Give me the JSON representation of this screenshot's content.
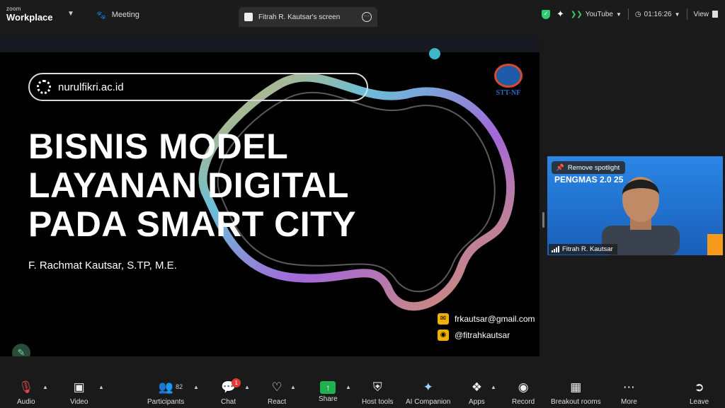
{
  "topbar": {
    "brand_small": "zoom",
    "brand_big": "Workplace",
    "meeting_label": "Meeting",
    "share_tab_label": "Fitrah R. Kautsar's screen",
    "youtube_label": "YouTube",
    "timer": "01:16:26",
    "view_label": "View"
  },
  "slide": {
    "url": "nurulfikri.ac.id",
    "title_line1": "BISNIS MODEL",
    "title_line2": "LAYANAN DIGITAL",
    "title_line3": "PADA SMART CITY",
    "author": "F. Rachmat Kautsar, S.TP, M.E.",
    "logo_text": "STT-NF",
    "email": "frkautsar@gmail.com",
    "instagram": "@fitrahkautsar"
  },
  "video": {
    "spotlight_label": "Remove spotlight",
    "participant_name": "Fitrah R. Kautsar",
    "banner_text": "PENGMAS 2.0   25"
  },
  "toolbar": {
    "audio": "Audio",
    "video": "Video",
    "participants": "Participants",
    "participants_count": "82",
    "chat": "Chat",
    "chat_badge": "1",
    "react": "React",
    "share": "Share",
    "host_tools": "Host tools",
    "ai_companion": "AI Companion",
    "apps": "Apps",
    "record": "Record",
    "breakout_rooms": "Breakout rooms",
    "more": "More",
    "leave": "Leave"
  },
  "colors": {
    "share_green": "#20b050",
    "leave_red": "#ff5050",
    "chat_badge_red": "#e53935",
    "slide_logo_blue": "#1e5ba8",
    "video_bg_blue": "#1c6fd0"
  }
}
